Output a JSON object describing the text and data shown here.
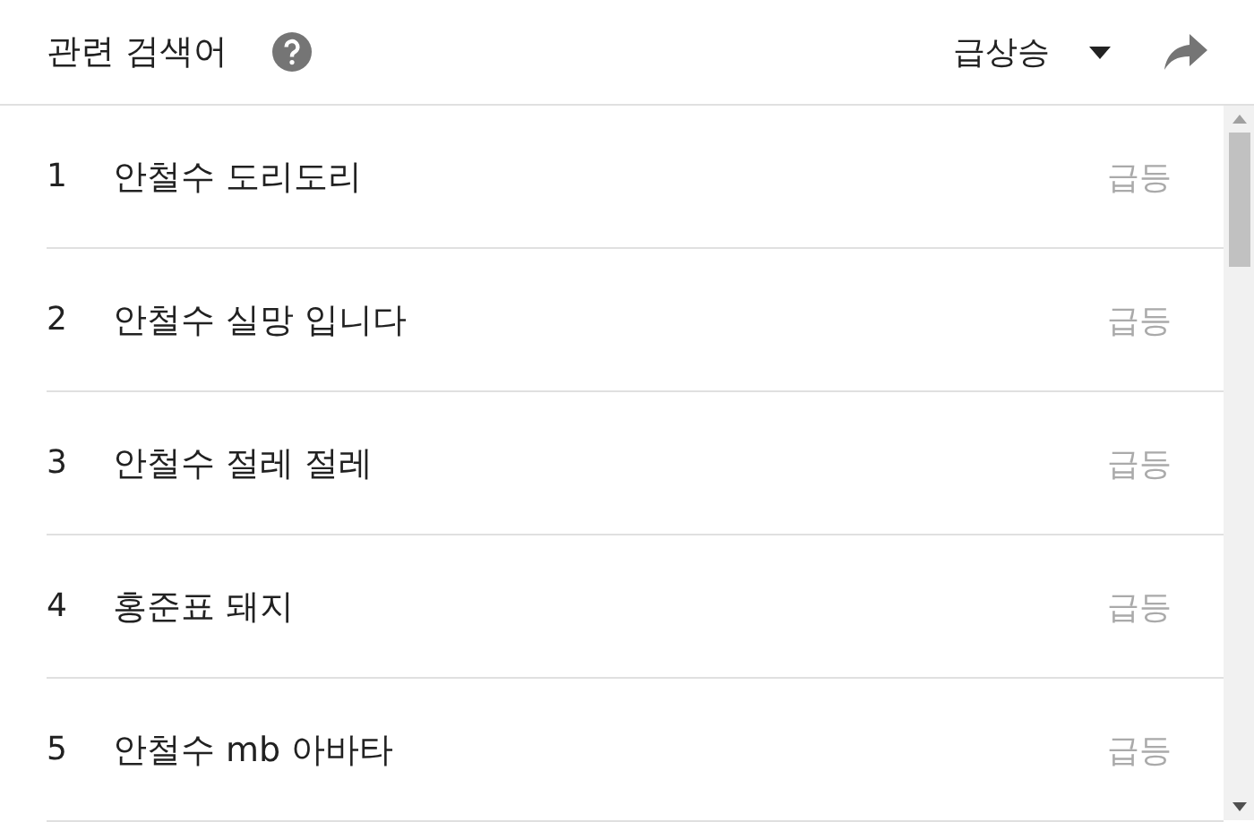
{
  "header": {
    "title": "관련 검색어",
    "sort": "급상승"
  },
  "rows": [
    {
      "rank": "1",
      "query": "안철수 도리도리",
      "value": "급등"
    },
    {
      "rank": "2",
      "query": "안철수 실망 입니다",
      "value": "급등"
    },
    {
      "rank": "3",
      "query": "안철수 절레 절레",
      "value": "급등"
    },
    {
      "rank": "4",
      "query": "홍준표 돼지",
      "value": "급등"
    },
    {
      "rank": "5",
      "query": "안철수 mb 아바타",
      "value": "급등"
    }
  ]
}
